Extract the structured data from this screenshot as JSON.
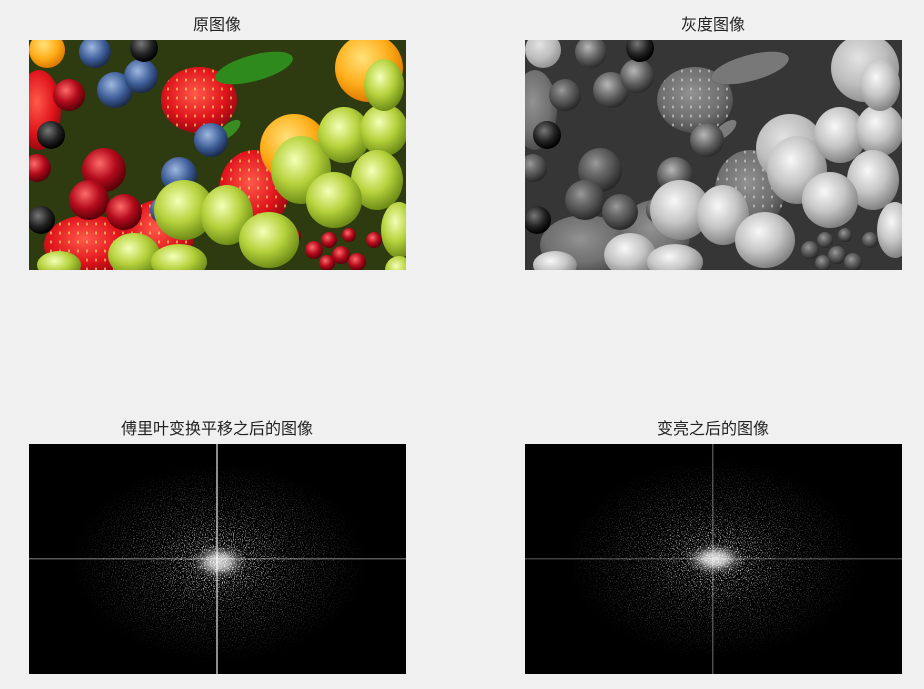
{
  "window": {
    "background": "#f0f0f0"
  },
  "panels": [
    {
      "title": "原图像",
      "image": "fruit-photo-color"
    },
    {
      "title": "灰度图像",
      "image": "fruit-photo-grayscale"
    },
    {
      "title": "傅里叶变换平移之后的图像",
      "image": "fft-shifted-spectrum"
    },
    {
      "title": "变亮之后的图像",
      "image": "fft-brightened-spectrum"
    }
  ]
}
